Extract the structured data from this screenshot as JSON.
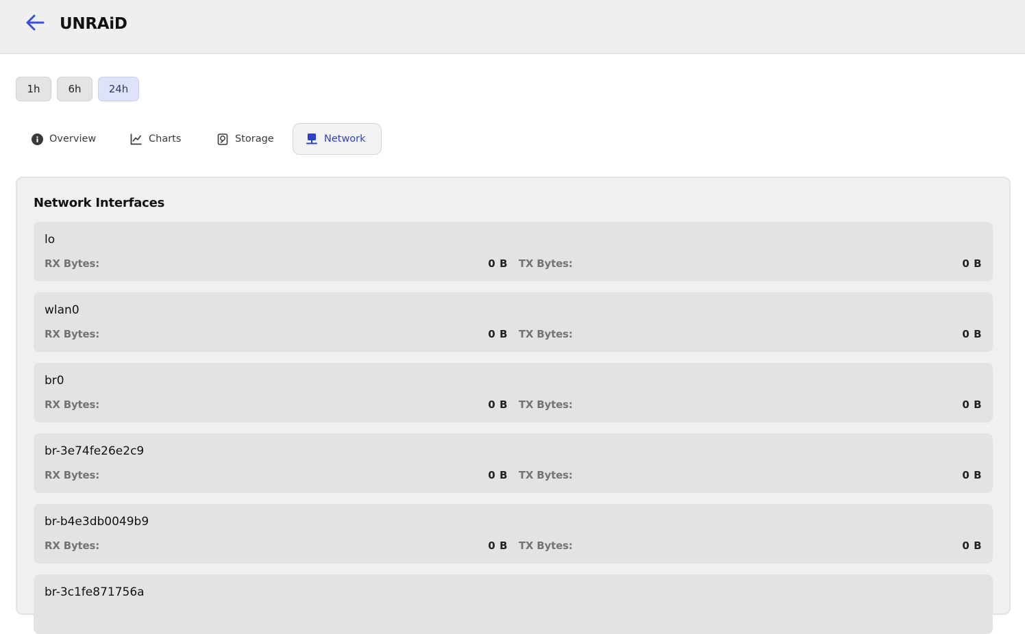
{
  "header": {
    "title": "UNRAiD",
    "back_icon": "arrow-left-icon",
    "accent_color": "#2d41c8"
  },
  "time_ranges": {
    "options": [
      "1h",
      "6h",
      "24h"
    ],
    "selected": "24h"
  },
  "tabs": [
    {
      "label": "Overview",
      "icon": "info-icon"
    },
    {
      "label": "Charts",
      "icon": "line-chart-icon"
    },
    {
      "label": "Storage",
      "icon": "hard-drive-icon"
    },
    {
      "label": "Network",
      "icon": "network-icon",
      "active": true
    }
  ],
  "network": {
    "title": "Network Interfaces",
    "rx_label": "RX Bytes:",
    "tx_label": "TX Bytes:",
    "interfaces": [
      {
        "name": "lo",
        "rx": "0 B",
        "tx": "0 B"
      },
      {
        "name": "wlan0",
        "rx": "0 B",
        "tx": "0 B"
      },
      {
        "name": "br0",
        "rx": "0 B",
        "tx": "0 B"
      },
      {
        "name": "br-3e74fe26e2c9",
        "rx": "0 B",
        "tx": "0 B"
      },
      {
        "name": "br-b4e3db0049b9",
        "rx": "0 B",
        "tx": "0 B"
      },
      {
        "name": "br-3c1fe871756a",
        "rx": "",
        "tx": ""
      }
    ]
  }
}
